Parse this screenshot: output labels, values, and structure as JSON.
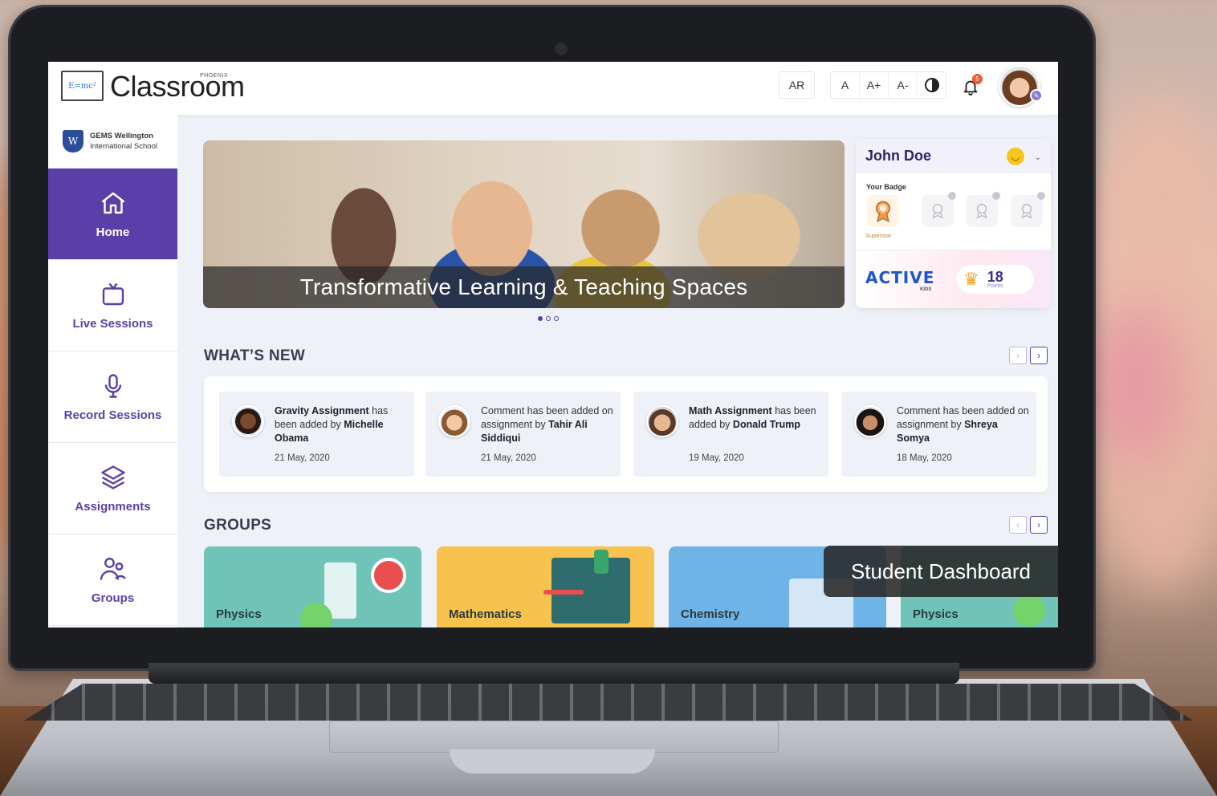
{
  "app": {
    "brand": "Classroom",
    "brand_super": "PHOENIX",
    "logo_text": "E=mc²"
  },
  "topbar": {
    "lang_button": "AR",
    "font_buttons": [
      "A",
      "A+",
      "A-"
    ],
    "notification_count": "5"
  },
  "sidebar": {
    "school_line1": "GEMS Wellington",
    "school_line2": "International School",
    "items": [
      {
        "label": "Home",
        "icon": "home-icon",
        "active": true
      },
      {
        "label": "Live Sessions",
        "icon": "tv-icon",
        "active": false
      },
      {
        "label": "Record Sessions",
        "icon": "microphone-icon",
        "active": false
      },
      {
        "label": "Assignments",
        "icon": "layers-icon",
        "active": false
      },
      {
        "label": "Groups",
        "icon": "users-icon",
        "active": false
      }
    ]
  },
  "hero": {
    "caption": "Transformative Learning & Teaching Spaces",
    "slides": 3,
    "current": 1
  },
  "profile": {
    "name": "John Doe",
    "badge_label": "Your Badge",
    "badge_earned": "Superstar",
    "points": "18",
    "points_label": "Points",
    "active_logo": "ACTIVE",
    "active_sub": "KIDS"
  },
  "whats_new": {
    "title": "WHAT’S NEW",
    "items": [
      {
        "pre": "",
        "bold1": "Gravity Assignment",
        "mid": " has been added by ",
        "bold2": "Michelle Obama",
        "date": "21 May, 2020"
      },
      {
        "pre": "Comment has been added on assignment by ",
        "bold1": "",
        "mid": "",
        "bold2": "Tahir Ali Siddiqui",
        "date": "21 May, 2020"
      },
      {
        "pre": "",
        "bold1": "Math Assignment",
        "mid": " has been added by ",
        "bold2": "Donald Trump",
        "date": "19 May, 2020"
      },
      {
        "pre": "Comment has been added on assignment by ",
        "bold1": "",
        "mid": "",
        "bold2": "Shreya Somya",
        "date": "18 May, 2020"
      }
    ]
  },
  "groups": {
    "title": "GROUPS",
    "items": [
      "Physics",
      "Mathematics",
      "Chemistry",
      "Physics"
    ]
  },
  "overlay": "Student Dashboard",
  "colors": {
    "accent": "#5b3fa8",
    "physics": "#6fc4b7",
    "maths": "#f7c24e",
    "chemistry": "#6fb4e6"
  }
}
